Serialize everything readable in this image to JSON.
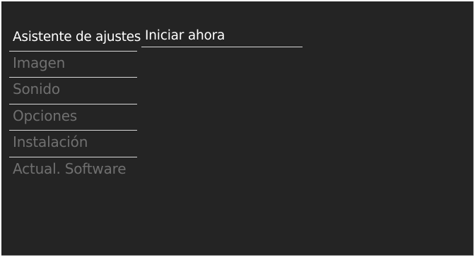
{
  "menu": {
    "items": [
      {
        "label": "Asistente de ajustes",
        "selected": true
      },
      {
        "label": "Imagen",
        "selected": false
      },
      {
        "label": "Sonido",
        "selected": false
      },
      {
        "label": "Opciones",
        "selected": false
      },
      {
        "label": "Instalación",
        "selected": false
      },
      {
        "label": "Actual. Software",
        "selected": false
      }
    ]
  },
  "submenu": {
    "items": [
      {
        "label": "Iniciar ahora"
      }
    ]
  },
  "colors": {
    "background": "#242424",
    "selected_text": "#ffffff",
    "dimmed_text": "#707070",
    "divider": "#d8d8d8"
  }
}
